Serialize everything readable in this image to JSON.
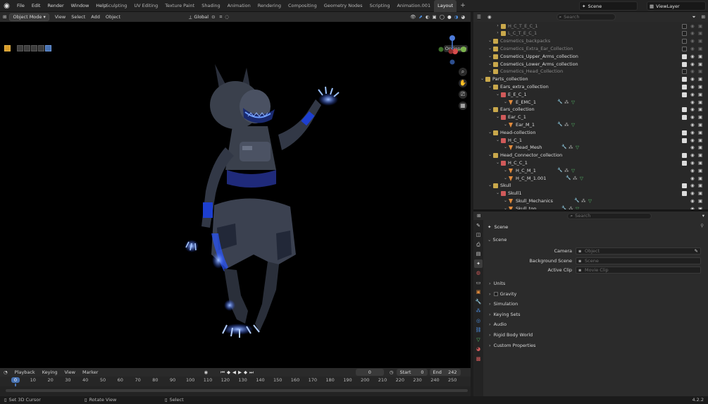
{
  "topbar": {
    "menus": [
      "File",
      "Edit",
      "Render",
      "Window",
      "Help"
    ],
    "workspaces": [
      "Sculpting",
      "UV Editing",
      "Texture Paint",
      "Shading",
      "Animation",
      "Rendering",
      "Compositing",
      "Geometry Nodes",
      "Scripting",
      "Animation.001",
      "Layout"
    ],
    "active_workspace": "Layout",
    "add_tab": "+",
    "scene_name": "Scene",
    "view_layer_name": "ViewLayer"
  },
  "viewport_header": {
    "mode": "Object Mode",
    "menus": [
      "View",
      "Select",
      "Add",
      "Object"
    ],
    "orientation": "Global",
    "options_label": "Options"
  },
  "outliner": {
    "search_placeholder": "Search",
    "rows": [
      {
        "label": "H_C_T_E_C_1",
        "kind": "collection",
        "indent": 3,
        "dim": true,
        "expand": false
      },
      {
        "label": "L_C_T_E_C_1",
        "kind": "collection",
        "indent": 3,
        "dim": true,
        "expand": false
      },
      {
        "label": "Cosmetics_backpacks",
        "kind": "collection",
        "indent": 2,
        "dim": true,
        "expand": true
      },
      {
        "label": "Cosmetics_Extra_Ear_Collection",
        "kind": "collection",
        "indent": 2,
        "dim": true,
        "expand": true
      },
      {
        "label": "Cosmetics_Upper_Arms_collection",
        "kind": "collection",
        "indent": 2,
        "dim": false,
        "expand": true
      },
      {
        "label": "Cosmetics_Lower_Arms_collection",
        "kind": "collection",
        "indent": 2,
        "dim": false,
        "expand": true
      },
      {
        "label": "Cosmetics_Head_Collection",
        "kind": "collection",
        "indent": 2,
        "dim": true,
        "expand": true
      },
      {
        "label": "Parts_collection",
        "kind": "collection",
        "indent": 1,
        "dim": false,
        "expand": true
      },
      {
        "label": "Ears_extra_collection",
        "kind": "collection",
        "indent": 2,
        "dim": false,
        "expand": true
      },
      {
        "label": "E_E_C_1",
        "kind": "collection_red",
        "indent": 3,
        "dim": false,
        "expand": true
      },
      {
        "label": "E_EMC_1",
        "kind": "mesh",
        "indent": 4,
        "dim": false,
        "expand": true
      },
      {
        "label": "Ears_collection",
        "kind": "collection",
        "indent": 2,
        "dim": false,
        "expand": true
      },
      {
        "label": "Ear_C_1",
        "kind": "collection_red",
        "indent": 3,
        "dim": false,
        "expand": true
      },
      {
        "label": "Ear_M_1",
        "kind": "mesh",
        "indent": 4,
        "dim": false,
        "expand": true
      },
      {
        "label": "Head-collection",
        "kind": "collection",
        "indent": 2,
        "dim": false,
        "expand": true
      },
      {
        "label": "H_C_1",
        "kind": "collection_red",
        "indent": 3,
        "dim": false,
        "expand": true
      },
      {
        "label": "Head_Mesh",
        "kind": "mesh",
        "indent": 4,
        "dim": false,
        "expand": true
      },
      {
        "label": "Head_Connector_collection",
        "kind": "collection",
        "indent": 2,
        "dim": false,
        "expand": true
      },
      {
        "label": "H_C_C_1",
        "kind": "collection_red",
        "indent": 3,
        "dim": false,
        "expand": true
      },
      {
        "label": "H_C_M_1",
        "kind": "mesh",
        "indent": 4,
        "dim": false,
        "expand": true
      },
      {
        "label": "H_C_M_1.001",
        "kind": "mesh",
        "indent": 4,
        "dim": false,
        "expand": true
      },
      {
        "label": "Skull",
        "kind": "collection",
        "indent": 2,
        "dim": false,
        "expand": true
      },
      {
        "label": "Skull1",
        "kind": "collection_red",
        "indent": 3,
        "dim": false,
        "expand": true
      },
      {
        "label": "Skull_Mechanics",
        "kind": "mesh",
        "indent": 4,
        "dim": false,
        "expand": true
      },
      {
        "label": "Skull_top",
        "kind": "mesh",
        "indent": 4,
        "dim": false,
        "expand": true
      }
    ]
  },
  "properties": {
    "search_placeholder": "Search",
    "context": "Scene",
    "panel_title": "Scene",
    "fields": [
      {
        "label": "Camera",
        "placeholder": "Object"
      },
      {
        "label": "Background Scene",
        "placeholder": "Scene"
      },
      {
        "label": "Active Clip",
        "placeholder": "Movie Clip"
      }
    ],
    "sections": [
      "Units",
      "Gravity",
      "Simulation",
      "Keying Sets",
      "Audio",
      "Rigid Body World",
      "Custom Properties"
    ]
  },
  "timeline": {
    "menus": [
      "Playback",
      "Keying",
      "View",
      "Marker"
    ],
    "current_frame": "0",
    "start_label": "Start",
    "start_value": "0",
    "end_label": "End",
    "end_value": "242",
    "ticks": [
      "0",
      "10",
      "20",
      "30",
      "40",
      "50",
      "60",
      "70",
      "80",
      "90",
      "100",
      "110",
      "120",
      "130",
      "140",
      "150",
      "160",
      "170",
      "180",
      "190",
      "200",
      "210",
      "220",
      "230",
      "240",
      "250"
    ]
  },
  "statusbar": {
    "items": [
      "Set 3D Cursor",
      "Rotate View",
      "Select"
    ],
    "version": "4.2.2"
  },
  "colors": {
    "accent": "#4772b3",
    "collection_icon": "#c9a84b",
    "collection_red": "#d05a5a",
    "mesh_icon": "#e08a3c",
    "glow": "#4d7bff"
  }
}
